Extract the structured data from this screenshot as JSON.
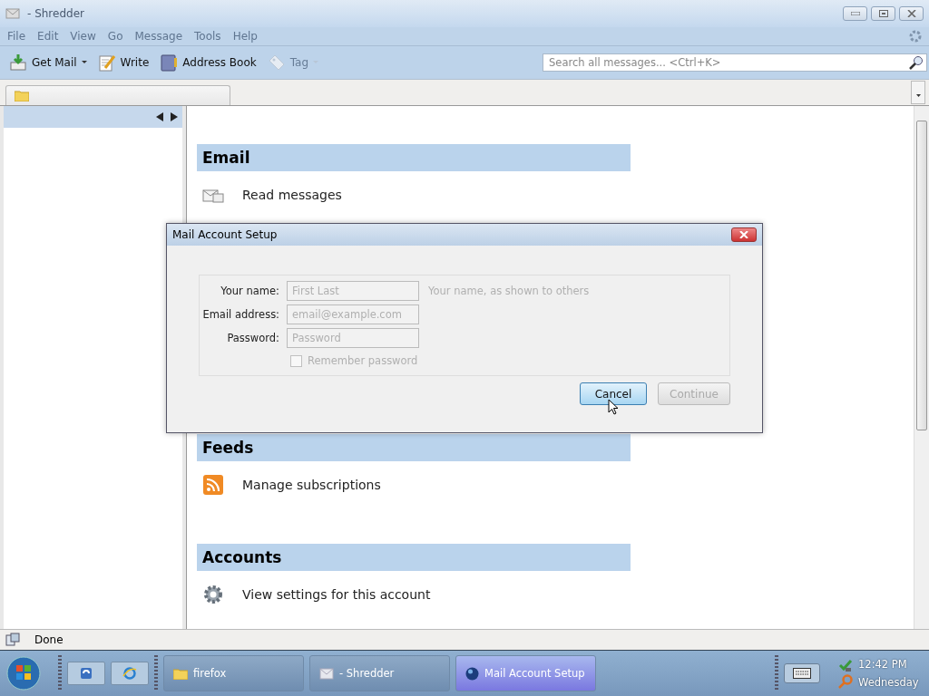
{
  "window": {
    "title": "- Shredder"
  },
  "menu": [
    {
      "label": "File",
      "disabled": true
    },
    {
      "label": "Edit",
      "disabled": true
    },
    {
      "label": "View",
      "disabled": true
    },
    {
      "label": "Go",
      "disabled": true
    },
    {
      "label": "Message",
      "disabled": true
    },
    {
      "label": "Tools",
      "disabled": true
    },
    {
      "label": "Help",
      "disabled": true
    }
  ],
  "toolbar": [
    {
      "kind": "getmail",
      "label": "Get Mail",
      "disabled": false
    },
    {
      "kind": "write",
      "label": "Write",
      "disabled": false
    },
    {
      "kind": "addressbook",
      "label": "Address Book",
      "disabled": false
    },
    {
      "kind": "tag",
      "label": "Tag",
      "disabled": true
    }
  ],
  "search": {
    "placeholder": "Search all messages... <Ctrl+K>"
  },
  "sections": [
    {
      "title": "Email",
      "items": [
        {
          "kind": "mail",
          "label": "Read messages"
        }
      ]
    },
    {
      "title": "Feeds",
      "items": [
        {
          "kind": "rss",
          "label": "Manage subscriptions"
        }
      ]
    },
    {
      "title": "Accounts",
      "items": [
        {
          "kind": "gear",
          "label": "View settings for this account"
        }
      ]
    }
  ],
  "status_bar": {
    "text": "Done"
  },
  "dialog": {
    "title": "Mail Account Setup",
    "fields": [
      {
        "label": "Your name:",
        "placeholder": "First Last",
        "hint": "Your name, as shown to others"
      },
      {
        "label": "Email address:",
        "placeholder": "email@example.com"
      },
      {
        "label": "Password:",
        "placeholder": "Password"
      }
    ],
    "remember": {
      "label": "Remember password",
      "checked": false,
      "disabled": true
    },
    "buttons": [
      {
        "label": "Cancel",
        "selected": true,
        "disabled": false
      },
      {
        "label": "Continue",
        "selected": false,
        "disabled": true
      }
    ]
  },
  "taskbar": {
    "tasks": [
      {
        "kind": "folder",
        "label": "firefox",
        "selected": false
      },
      {
        "kind": "mail",
        "label": "- Shredder",
        "selected": false
      },
      {
        "kind": "globe",
        "label": "Mail Account Setup",
        "selected": true
      }
    ],
    "time": "12:42 PM",
    "day": "Wednesday"
  }
}
